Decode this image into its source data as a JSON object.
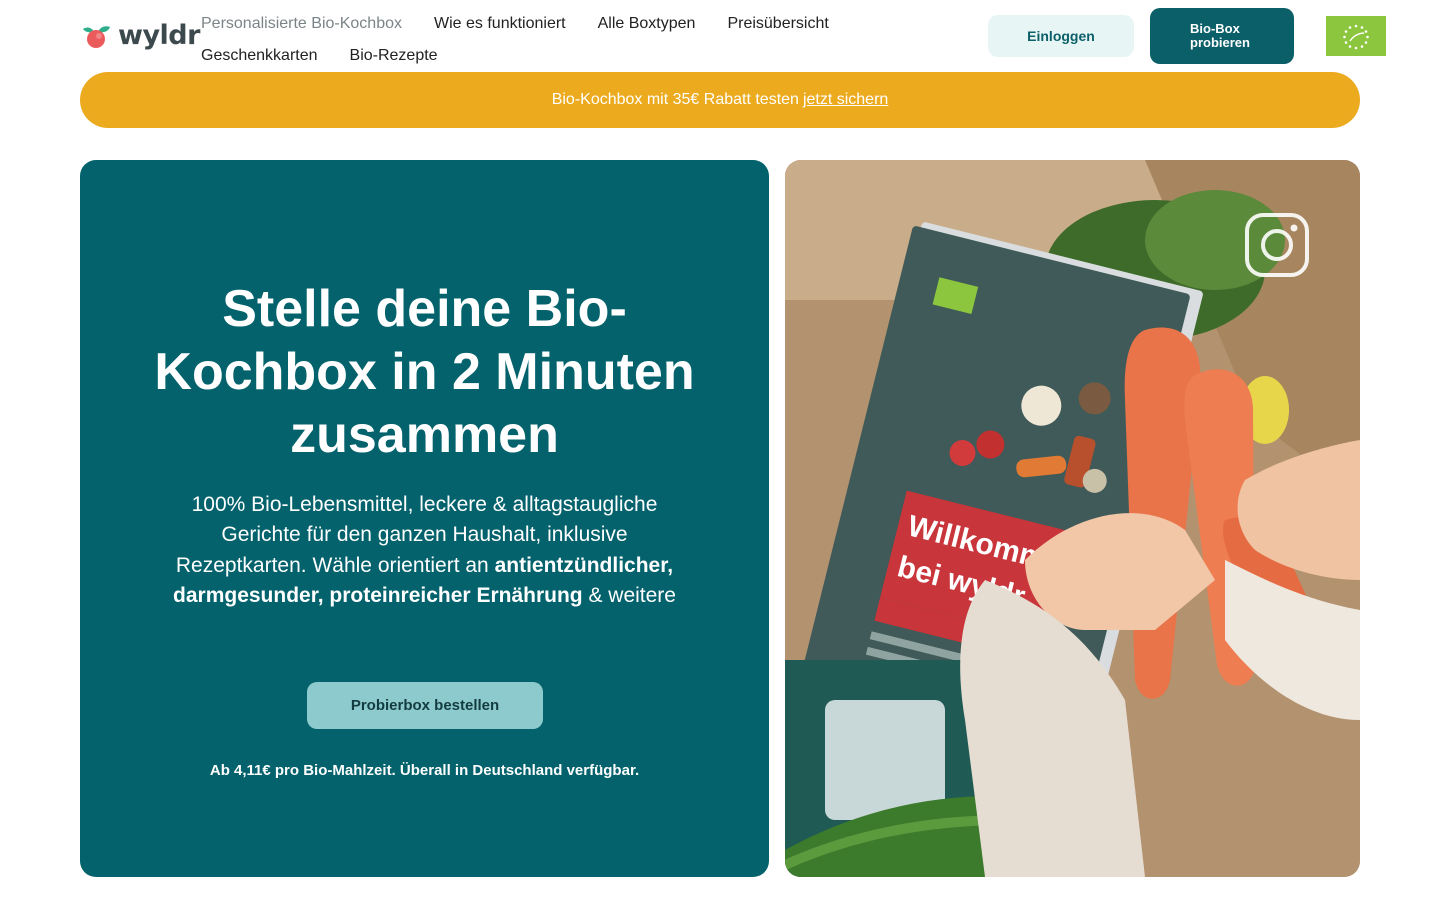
{
  "brand": {
    "name": "wyldr"
  },
  "nav": {
    "row1": [
      "Personalisierte Bio-Kochbox",
      "Wie es funktioniert",
      "Alle Boxtypen",
      "Preisübersicht"
    ],
    "row2": [
      "Geschenkkarten",
      "Bio-Rezepte"
    ]
  },
  "header": {
    "login_label": "Einloggen",
    "try_label": "Bio-Box probieren"
  },
  "promo": {
    "text": "Bio-Kochbox mit 35€ Rabatt testen",
    "link": "jetzt sichern"
  },
  "hero": {
    "title": "Stelle deine Bio-Kochbox in 2 Minuten zusammen",
    "desc_1": "100% Bio-Lebensmittel, leckere & alltagstaugliche Gerichte für den ganzen Haushalt, inklusive Rezeptkarten. Wähle orientiert an ",
    "desc_bold": "antientzündlicher, darmgesunder, proteinreicher Ernährung",
    "desc_2": " & weitere",
    "cta_label": "Probierbox bestellen",
    "note": "Ab 4,11€ pro Bio-Mahlzeit. Überall in Deutschland verfügbar."
  },
  "photo": {
    "card_text_1": "Willkommen",
    "card_text_2": "bei wyldr"
  },
  "colors": {
    "teal": "#03626c",
    "promo": "#ecab1e",
    "cta": "#8ccacd",
    "eu_green": "#8cc63f"
  },
  "icons": [
    "wyldr-logo-icon",
    "eu-organic-icon",
    "instagram-icon"
  ]
}
